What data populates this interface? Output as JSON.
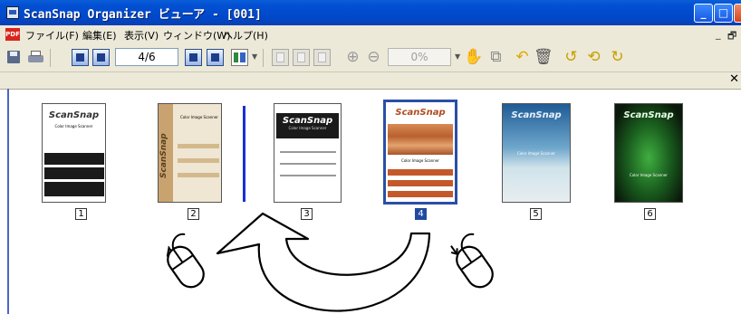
{
  "window": {
    "title": "ScanSnap Organizer ビューア - [001]",
    "controls": {
      "minimize": "_",
      "maximize": "□",
      "close": "✕"
    }
  },
  "menubar": {
    "pdf_badge": "PDF",
    "items": [
      "ファイル(F)",
      "編集(E)",
      "表示(V)",
      "ウィンドウ(W)",
      "ヘルプ(H)"
    ],
    "mdi_minimize": "_",
    "mdi_restore": "🗗"
  },
  "toolbar": {
    "page_indicator": "4/6",
    "zoom_value": "0%"
  },
  "panel": {
    "close_glyph": "✕"
  },
  "thumbnails": [
    {
      "number": "1",
      "brand": "ScanSnap",
      "caption": "Color Image Scanner",
      "selected": false
    },
    {
      "number": "2",
      "brand": "ScanSnap",
      "caption": "Color Image Scanner",
      "selected": false
    },
    {
      "number": "3",
      "brand": "ScanSnap",
      "caption": "Color Image Scanner",
      "selected": false
    },
    {
      "number": "4",
      "brand": "ScanSnap",
      "caption": "Color Image Scanner",
      "selected": true
    },
    {
      "number": "5",
      "brand": "ScanSnap",
      "caption": "Color Image Scanner",
      "selected": false
    },
    {
      "number": "6",
      "brand": "ScanSnap",
      "caption": "Color Image Scanner",
      "selected": false
    }
  ],
  "colors": {
    "titlebar": "#0350d3",
    "selection": "#1f4aa0",
    "insertion_marker": "#1a2fd6"
  }
}
